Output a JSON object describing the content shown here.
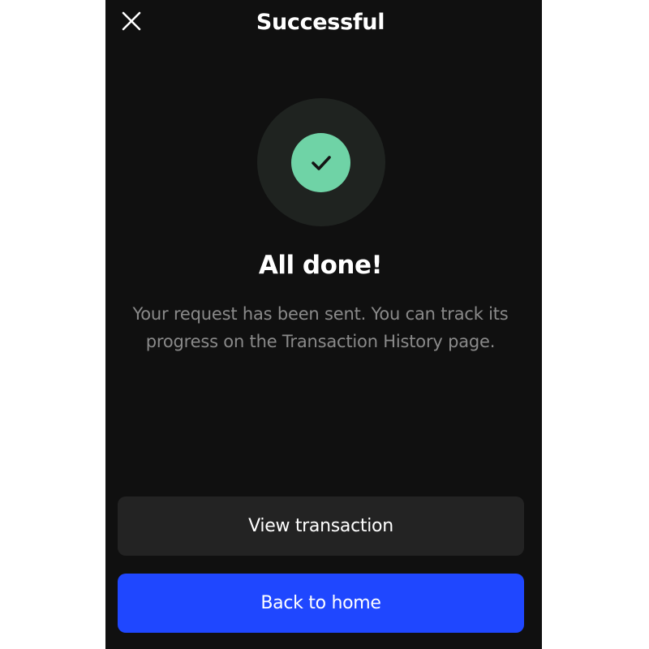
{
  "header": {
    "title": "Successful",
    "close_icon": "close-icon"
  },
  "status": {
    "icon": "check-icon",
    "accent_color": "#6fd3a6",
    "headline": "All done!",
    "message": "Your request has been sent. You can track its progress on the Transaction History page."
  },
  "actions": {
    "view_label": "View transaction",
    "home_label": "Back to home",
    "primary_color": "#1f47ff"
  }
}
